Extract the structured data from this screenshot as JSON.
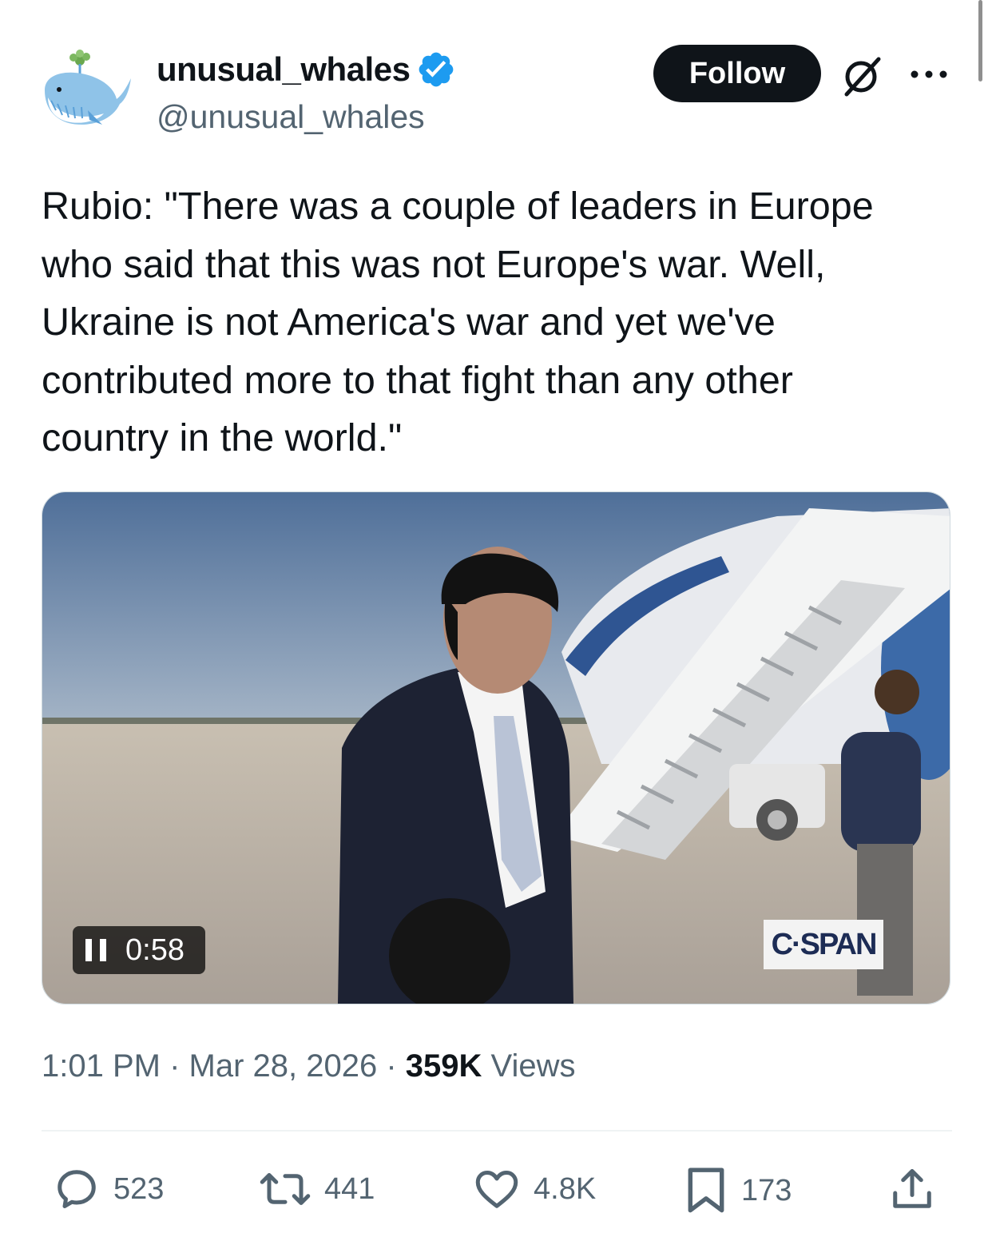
{
  "header": {
    "display_name": "unusual_whales",
    "handle": "@unusual_whales",
    "follow_label": "Follow",
    "icons": [
      "whale-avatar",
      "verified-badge-icon",
      "grok-icon",
      "more-icon"
    ]
  },
  "tweet": {
    "text": "Rubio: \"There was a couple of leaders in Europe\nwho said that this was not Europe's war. Well,\nUkraine is not America's war and yet we've\ncontributed more to that fight than any other\ncountry in the world.\""
  },
  "video": {
    "timecode": "0:58",
    "watermark": "C·SPAN"
  },
  "meta": {
    "time": "1:01 PM",
    "sep1": " · ",
    "date": "Mar 28, 2026",
    "sep2": " · ",
    "views_count": "359K",
    "views_label": " Views"
  },
  "actions": {
    "replies": "523",
    "reposts": "441",
    "likes": "4.8K",
    "bookmarks": "173"
  },
  "colors": {
    "text": "#0f1419",
    "secondary": "#536471",
    "verified": "#1d9bf0",
    "follow_bg": "#0f1419"
  }
}
